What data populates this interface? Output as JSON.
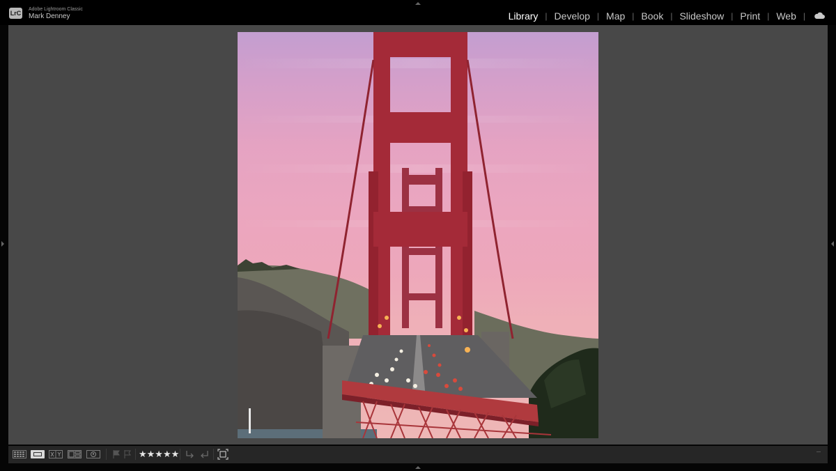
{
  "app": {
    "logo_text": "LrC",
    "product_name": "Adobe Lightroom Classic",
    "user_name": "Mark Denney"
  },
  "modules": [
    {
      "label": "Library",
      "active": true
    },
    {
      "label": "Develop",
      "active": false
    },
    {
      "label": "Map",
      "active": false
    },
    {
      "label": "Book",
      "active": false
    },
    {
      "label": "Slideshow",
      "active": false
    },
    {
      "label": "Print",
      "active": false
    },
    {
      "label": "Web",
      "active": false
    }
  ],
  "module_separator": "|",
  "icons": {
    "cloud": "cloud-icon",
    "grid_view": "grid-view-icon",
    "loupe_view": "loupe-view-icon",
    "compare_view": "compare-view-icon",
    "survey_view": "survey-view-icon",
    "people_view": "people-view-icon",
    "flag_pick": "flag-pick-icon",
    "flag_reject": "flag-reject-icon",
    "rotate_left": "rotate-left-icon",
    "rotate_right": "rotate-right-icon",
    "crop_overlay": "crop-overlay-icon"
  },
  "toolbar": {
    "rating_stars": "★★★★★",
    "rating_value": 5
  },
  "photo": {
    "subject": "Golden Gate Bridge at sunset"
  },
  "colors": {
    "background": "#484848",
    "topbar": "#000000",
    "toolbar": "#262626",
    "active_module": "#ffffff",
    "inactive_module": "#c8c8c8",
    "bridge_red": "#a42a38"
  }
}
